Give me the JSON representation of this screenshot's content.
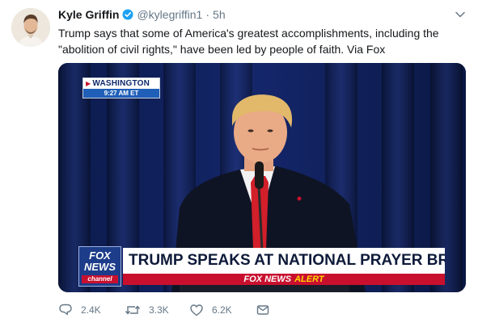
{
  "tweet": {
    "author_name": "Kyle Griffin",
    "author_handle": "@kylegriffin1",
    "separator": "·",
    "time": "5h",
    "text": "Trump says that some of America's greatest accomplishments, including the \"abolition of civil rights,\" have been led by people of faith. Via Fox"
  },
  "video": {
    "location": "WASHINGTON",
    "location_time": "9:27 AM ET",
    "logo_line1": "FOX",
    "logo_line2": "NEWS",
    "logo_line3": "channel",
    "headline": "TRUMP SPEAKS AT NATIONAL PRAYER BREAKFAST",
    "alert_brand": "FOX NEWS",
    "alert_word": "ALERT"
  },
  "actions": {
    "replies": "2.4K",
    "retweets": "3.3K",
    "likes": "6.2K"
  },
  "icons": {
    "verified": "verified-badge-icon",
    "caret": "chevron-down-icon",
    "reply": "reply-icon",
    "retweet": "retweet-icon",
    "like": "heart-icon",
    "dm": "envelope-icon"
  },
  "colors": {
    "verified_blue": "#1da1f2",
    "secondary_text": "#657786",
    "fox_red": "#c8102e",
    "fox_blue": "#1d3c8a"
  }
}
